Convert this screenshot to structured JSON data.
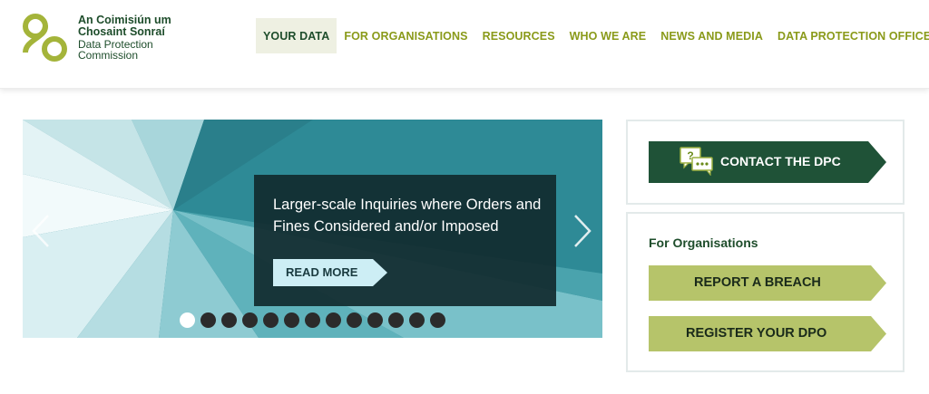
{
  "logo": {
    "line1": "An Coimisiún um",
    "line2": "Chosaint Sonraí",
    "line3": "Data Protection",
    "line4": "Commission"
  },
  "nav": {
    "items": [
      {
        "label": "YOUR DATA",
        "active": true
      },
      {
        "label": "FOR ORGANISATIONS"
      },
      {
        "label": "RESOURCES"
      },
      {
        "label": "WHO WE ARE"
      },
      {
        "label": "NEWS AND MEDIA"
      },
      {
        "label": "DATA PROTECTION OFFICERS"
      }
    ]
  },
  "carousel": {
    "title": "Larger-scale Inquiries where Orders and Fines Considered and/or Imposed",
    "read_more": "READ MORE",
    "slide_count": 13,
    "active_index": 0
  },
  "contact": {
    "label": "CONTACT THE DPC"
  },
  "organisations": {
    "title": "For Organisations",
    "report_breach": "REPORT A BREACH",
    "register_dpo": "REGISTER YOUR DPO"
  },
  "colors": {
    "brand_dark_green": "#1e4d2b",
    "brand_olive": "#8a9a1a",
    "lime_button": "#b6c46a",
    "contact_green": "#1f5237",
    "carousel_teal": "#2e8a96"
  }
}
